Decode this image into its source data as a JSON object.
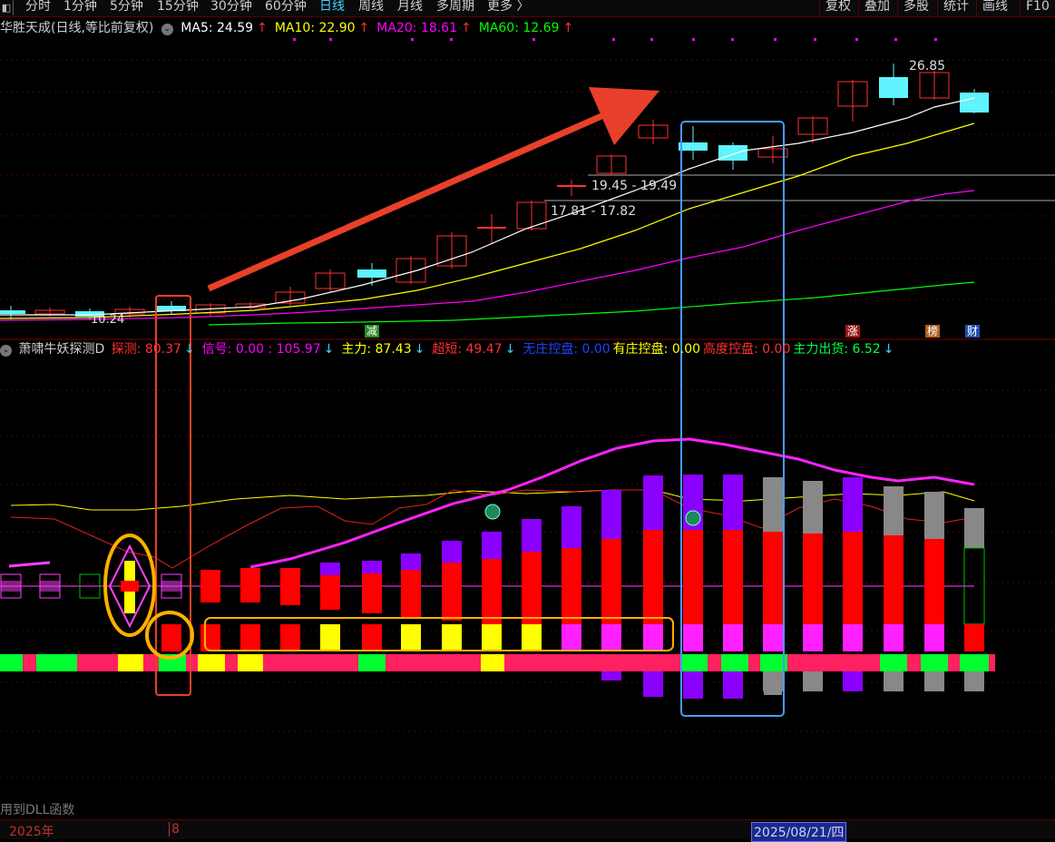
{
  "toolbar": {
    "icon": "square-icon",
    "tabs": [
      "分时",
      "1分钟",
      "5分钟",
      "15分钟",
      "30分钟",
      "60分钟",
      "日线",
      "周线",
      "月线",
      "多周期",
      "更多 〉"
    ],
    "active_tab": "日线",
    "right_buttons": [
      "复权",
      "叠加",
      "多股",
      "统计",
      "画线",
      "F10"
    ]
  },
  "main_chart": {
    "title": "华胜天成(日线,等比前复权)",
    "ma": [
      {
        "label": "MA5: 24.59",
        "arrow": "↑",
        "color": "#ffffff"
      },
      {
        "label": "MA10: 22.90",
        "arrow": "↑",
        "color": "#ffff00"
      },
      {
        "label": "MA20: 18.61",
        "arrow": "↑",
        "color": "#ff00ff"
      },
      {
        "label": "MA60: 12.69",
        "arrow": "↑",
        "color": "#00ff00"
      }
    ],
    "high_label": "26.85",
    "low_label": "10.24",
    "range1": "19.45 - 19.49",
    "range2": "17.81 - 17.82",
    "markers": [
      {
        "text": "减",
        "color": "#2a8a2a"
      },
      {
        "text": "涨",
        "color": "#a01818"
      },
      {
        "text": "榜",
        "color": "#b06020"
      },
      {
        "text": "财",
        "color": "#2050b0"
      }
    ]
  },
  "indicator": {
    "title": "萧啸牛妖探测D",
    "items": [
      {
        "label": "探测: 80.37",
        "arrow": "↓",
        "color": "#ff3030",
        "arrow_color": "#3fd4ff"
      },
      {
        "label": "信号: 0.00 : 105.97",
        "arrow": "↓",
        "color": "#ff00ff",
        "arrow_color": "#3fd4ff"
      },
      {
        "label": "主力: 87.43",
        "arrow": "↓",
        "color": "#ffff00",
        "arrow_color": "#3fd4ff"
      },
      {
        "label": "超短: 49.47",
        "arrow": "↓",
        "color": "#ff3030",
        "arrow_color": "#3fd4ff"
      },
      {
        "label": "无庄控盘: 0.00",
        "arrow": "",
        "color": "#2040ff",
        "arrow_color": ""
      },
      {
        "label": "有庄控盘: 0.00",
        "arrow": "",
        "color": "#ffff00",
        "arrow_color": ""
      },
      {
        "label": "高度控盘: 0.00",
        "arrow": "",
        "color": "#ff3030",
        "arrow_color": ""
      },
      {
        "label": "主力出货: 6.52",
        "arrow": "↓",
        "color": "#00ff40",
        "arrow_color": "#3fd4ff"
      }
    ]
  },
  "footer": {
    "dll_text": "用到DLL函数"
  },
  "timeline": {
    "year": "2025年",
    "month": "8",
    "selected_date": "2025/08/21/四"
  }
}
